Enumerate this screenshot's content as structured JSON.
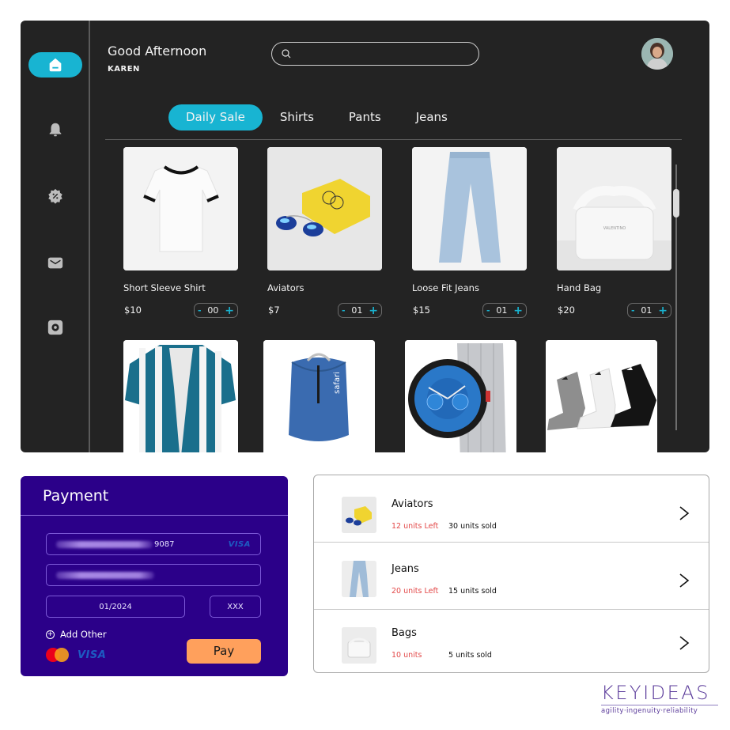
{
  "header": {
    "greeting": "Good Afternoon",
    "username": "KAREN",
    "search": {
      "placeholder": "",
      "value": ""
    }
  },
  "sidebar": {
    "items": [
      {
        "id": "home",
        "icon": "home-icon",
        "active": true
      },
      {
        "id": "notifications",
        "icon": "bell-icon",
        "active": false
      },
      {
        "id": "offers",
        "icon": "discount-badge-icon",
        "active": false
      },
      {
        "id": "messages",
        "icon": "mail-icon",
        "active": false
      },
      {
        "id": "settings",
        "icon": "gear-icon",
        "active": false
      }
    ]
  },
  "tabs": [
    {
      "label": "Daily Sale",
      "active": true
    },
    {
      "label": "Shirts",
      "active": false
    },
    {
      "label": "Pants",
      "active": false
    },
    {
      "label": "Jeans",
      "active": false
    }
  ],
  "products": [
    {
      "name": "Short Sleeve Shirt",
      "price": "$10",
      "qty": "00",
      "image": "white t-shirt"
    },
    {
      "name": "Aviators",
      "price": "$7",
      "qty": "01",
      "image": "aviator sunglasses with yellow box"
    },
    {
      "name": "Loose Fit Jeans",
      "price": "$15",
      "qty": "01",
      "image": "light blue jeans"
    },
    {
      "name": "Hand Bag",
      "price": "$20",
      "qty": "01",
      "image": "white woven handbag"
    },
    {
      "name": "",
      "price": "",
      "qty": "",
      "image": "striped teal shirt"
    },
    {
      "name": "",
      "price": "",
      "qty": "",
      "image": "blue safari backpack",
      "brand_text": "safari"
    },
    {
      "name": "",
      "price": "",
      "qty": "",
      "image": "silver smartwatch"
    },
    {
      "name": "",
      "price": "",
      "qty": "",
      "image": "three adidas socks"
    }
  ],
  "stepper": {
    "minus": "-",
    "plus": "+"
  },
  "payment": {
    "title": "Payment",
    "card_number_suffix": "9087",
    "card_brand": "VISA",
    "expiry": "01/2024",
    "cvv": "XXX",
    "add_other": "Add Other",
    "add_other_icon": "+",
    "accepted": [
      "Mastercard",
      "VISA"
    ],
    "pay_label": "Pay"
  },
  "inventory": [
    {
      "name": "Aviators",
      "left": "12 units Left",
      "sold": "30 units sold"
    },
    {
      "name": "Jeans",
      "left": "20 units Left",
      "sold": "15 units sold"
    },
    {
      "name": "Bags",
      "left": "10 units",
      "sold": "5 units sold"
    }
  ],
  "logo": {
    "word": "KEYIDEAS",
    "tagline": "agility·ingenuity·reliability"
  },
  "colors": {
    "accent": "#18b4d2",
    "app_bg": "#232323",
    "payment_bg": "#2b0089",
    "pay_button": "#ffa05c",
    "units_left": "#e34848"
  }
}
